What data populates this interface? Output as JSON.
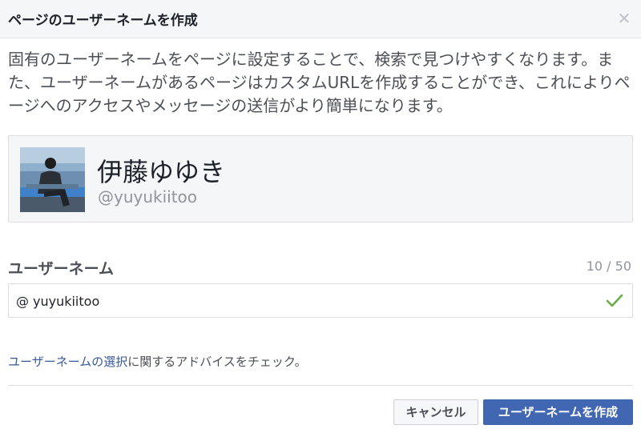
{
  "dialog": {
    "title": "ページのユーザーネームを作成",
    "close_icon": "close-icon",
    "description": "固有のユーザーネームをページに設定することで、検索で見つけやすくなります。また、ユーザーネームがあるページはカスタムURLを作成することができ、これによりページへのアクセスやメッセージの送信がより簡単になります。"
  },
  "preview": {
    "page_name": "伊藤ゆゆき",
    "handle": "@yuyukiitoo"
  },
  "username_field": {
    "label": "ユーザーネーム",
    "counter": "10 / 50",
    "prefix": "@",
    "value": "yuyukiitoo",
    "status_icon": "checkmark-icon"
  },
  "advice": {
    "link_text": "ユーザーネームの選択",
    "rest_text": "に関するアドバイスをチェック。"
  },
  "buttons": {
    "cancel": "キャンセル",
    "create": "ユーザーネームを作成"
  },
  "colors": {
    "primary": "#4267b2",
    "link": "#365899",
    "valid_check": "#6aae4a"
  }
}
